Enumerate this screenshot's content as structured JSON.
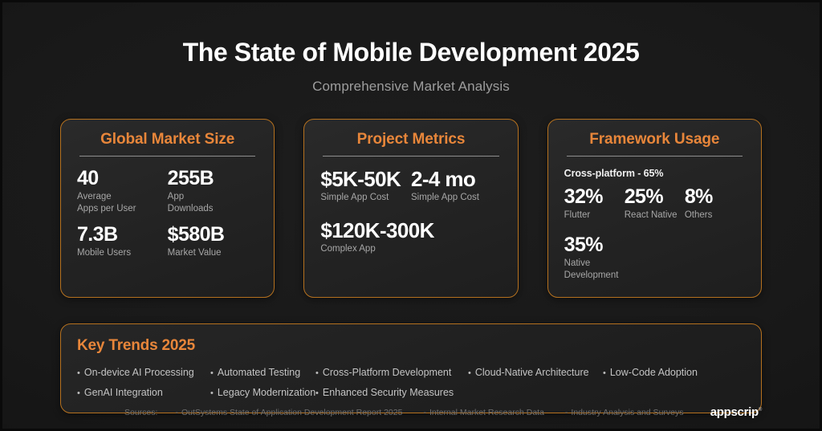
{
  "header": {
    "title": "The State of Mobile Development 2025",
    "subtitle": "Comprehensive Market Analysis"
  },
  "colors": {
    "accent_orange": "#e8863a",
    "card_border": "#b5711f",
    "page_background": "#191919",
    "value_text": "#ffffff",
    "label_text": "#a7a7a7"
  },
  "cards": [
    {
      "title": "Global Market Size",
      "stats": [
        {
          "value": "40",
          "label": "Average\nApps per User",
          "label_line1": "Average",
          "label_line2": "Apps per User"
        },
        {
          "value": "255B",
          "label": "App\nDownloads",
          "label_line1": "App",
          "label_line2": "Downloads"
        },
        {
          "value": "7.3B",
          "label": "Mobile Users",
          "label_line1": "Mobile Users",
          "label_line2": ""
        },
        {
          "value": "$580B",
          "label": "Market Value",
          "label_line1": "Market Value",
          "label_line2": ""
        }
      ]
    },
    {
      "title": "Project Metrics",
      "stats": [
        {
          "value": "$5K-50K",
          "label": "Simple App Cost"
        },
        {
          "value": "2-4 mo",
          "label": "Simple App Cost"
        },
        {
          "value": "$120K-300K",
          "label": "Complex App"
        }
      ]
    },
    {
      "title": "Framework Usage",
      "note": "Cross-platform - 65%",
      "stats": [
        {
          "value": "32%",
          "label": "Flutter"
        },
        {
          "value": "25%",
          "label": "React Native"
        },
        {
          "value": "8%",
          "label": "Others"
        },
        {
          "value": "35%",
          "label": "Native Development"
        }
      ]
    }
  ],
  "trends": {
    "title": "Key Trends 2025",
    "bullet": "•",
    "row1": [
      "On-device AI Processing",
      "Automated Testing",
      "Cross-Platform Development",
      "Cloud-Native Architecture",
      "Low-Code Adoption"
    ],
    "row2": [
      "GenAI Integration",
      "Legacy Modernization",
      "Enhanced Security Measures"
    ]
  },
  "footer": {
    "sources_label": "Sources:",
    "dash": "-",
    "sources": [
      "OutSystems State of Application Development Report 2025",
      "Internal Market Research Data",
      "Industry Analysis and Surveys"
    ],
    "logo": "appscrip",
    "logo_tm": "®"
  }
}
